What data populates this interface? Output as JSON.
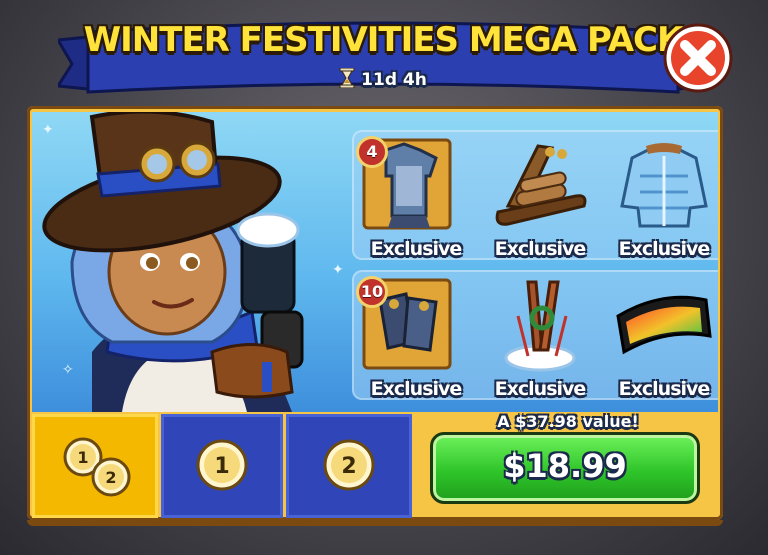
{
  "header": {
    "title": "WINTER FESTIVITIES MEGA PACK",
    "timer": "11d 4h"
  },
  "items": [
    {
      "label": "Exclusive",
      "badge": "4",
      "icon": "armor-icon"
    },
    {
      "label": "Exclusive",
      "badge": null,
      "icon": "sled-icon"
    },
    {
      "label": "Exclusive",
      "badge": null,
      "icon": "puffer-jacket-icon"
    },
    {
      "label": "Exclusive",
      "badge": "10",
      "icon": "gloves-icon"
    },
    {
      "label": "Exclusive",
      "badge": null,
      "icon": "skis-icon"
    },
    {
      "label": "Exclusive",
      "badge": null,
      "icon": "ski-goggles-icon"
    }
  ],
  "tabs": [
    {
      "icons": [
        "1",
        "2"
      ],
      "selected": true
    },
    {
      "icons": [
        "1"
      ],
      "selected": false
    },
    {
      "icons": [
        "2"
      ],
      "selected": false
    }
  ],
  "offer": {
    "value_text": "A $37.98 value!",
    "price": "$18.99"
  },
  "colors": {
    "title": "#ffe23a",
    "ribbon": "#2b3fb0",
    "buy_button": "#2fc52a",
    "tab_selected": "#f5b800",
    "tab_normal": "#3046b8",
    "close_button": "#e8432b"
  }
}
